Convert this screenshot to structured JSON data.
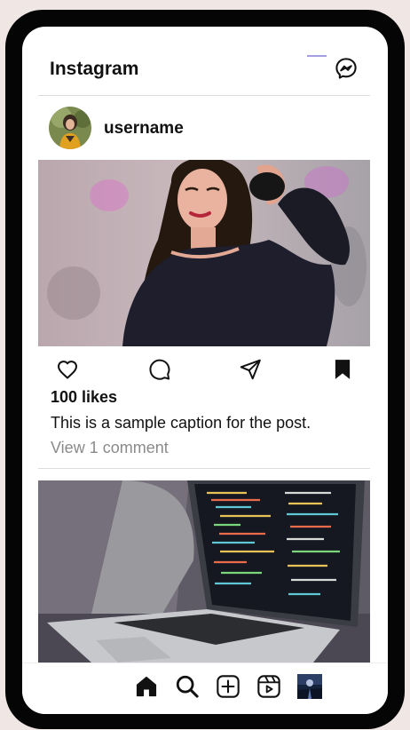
{
  "app": {
    "title": "Instagram"
  },
  "header": {
    "messenger_icon": "messenger-icon"
  },
  "post1": {
    "username": "username",
    "likes": "100 likes",
    "caption": "This is a sample caption for the post.",
    "comments_link": "View 1 comment"
  },
  "bottom_nav": {
    "items": [
      "home-icon",
      "search-icon",
      "add-post-icon",
      "reels-icon",
      "profile-thumbnail"
    ]
  }
}
